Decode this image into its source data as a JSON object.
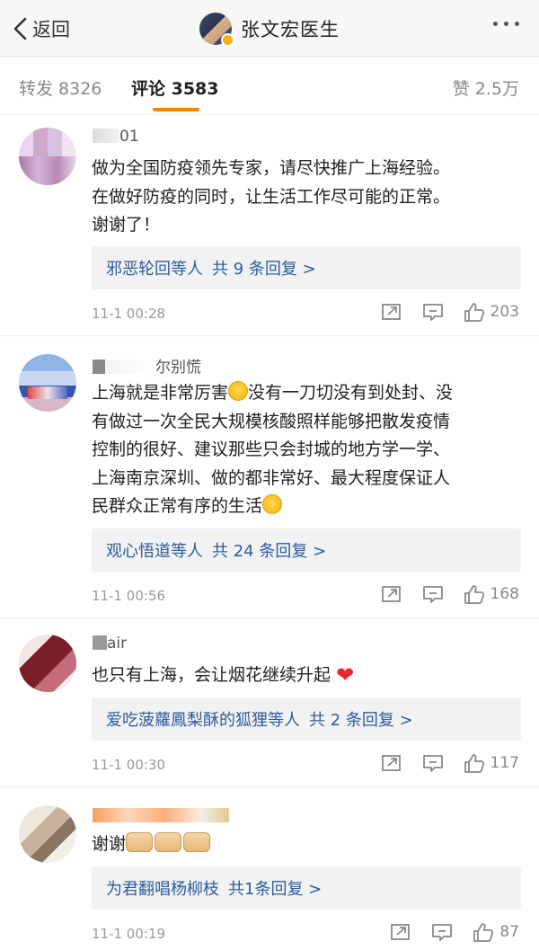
{
  "nav": {
    "back_label": "返回",
    "title": "张文宏医生"
  },
  "tabs": [
    {
      "label": "转发 8326"
    },
    {
      "label": "评论 3583"
    },
    {
      "label": "赞 2.5万"
    }
  ],
  "colors": {
    "accent": "#ff8200",
    "link": "#2b5d9e",
    "verified": "#f6b018"
  },
  "comments": [
    {
      "name": "01",
      "text_lines": [
        "做为全国防疫领先专家，请尽快推广上海经验。",
        "在做好防疫的同时，让生活工作尽可能的正常。",
        "谢谢了！"
      ],
      "reply_users": "邪恶轮回",
      "reply_suffix": "等人",
      "reply_count": "共 9 条回复 >",
      "time": "11-1 00:28",
      "likes": "203"
    },
    {
      "name": "尔别慌",
      "text_lines": [
        "上海就是非常厉害",
        "没有一刀切没有到处封、没",
        "有做过一次全民大规模核酸照样能够把散发疫情",
        "控制的很好、建议那些只会封城的地方学一学、",
        "上海南京深圳、做的都非常好、最大程度保证人",
        "民群众正常有序的生活"
      ],
      "reply_users": "观心悟道",
      "reply_suffix": "等人",
      "reply_count": "共 24 条回复 >",
      "time": "11-1 00:56",
      "likes": "168"
    },
    {
      "name": "air",
      "text_lines": [
        "也只有上海，会让烟花继续升起"
      ],
      "reply_users": "爱吃菠蘿鳳梨酥的狐狸",
      "reply_suffix": "等人",
      "reply_count": "共 2 条回复 >",
      "time": "11-1 00:30",
      "likes": "117"
    },
    {
      "name": "",
      "text_lines": [
        "谢谢"
      ],
      "reply_users": "为君翻唱杨柳枝",
      "reply_suffix": "",
      "reply_count": "共1条回复 >",
      "time": "11-1 00:19",
      "likes": "87"
    }
  ],
  "icons": {
    "repost": "share-icon",
    "comment": "comment-icon",
    "like": "thumbs-up-icon",
    "more": "more-icon"
  }
}
